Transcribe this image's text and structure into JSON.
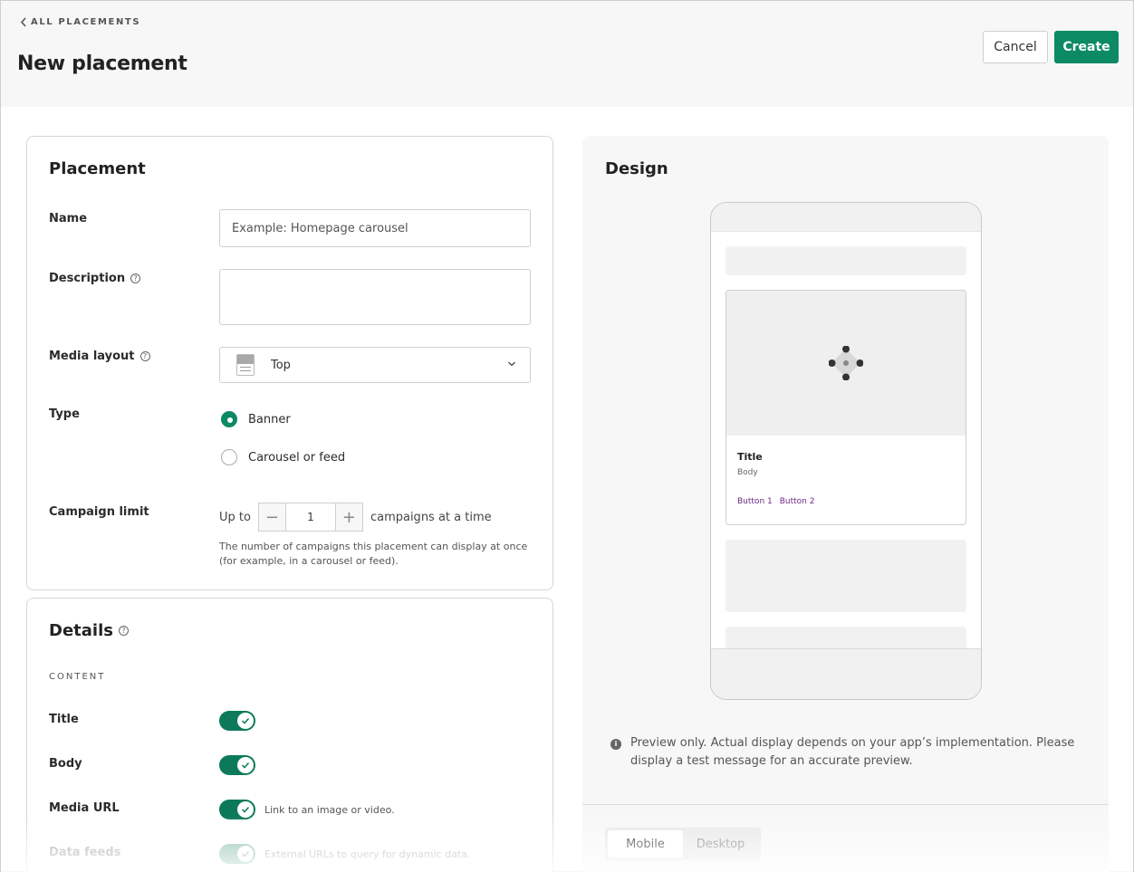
{
  "header": {
    "back_label": "ALL PLACEMENTS",
    "title": "New placement",
    "cancel_label": "Cancel",
    "create_label": "Create"
  },
  "placement": {
    "title": "Placement",
    "name_label": "Name",
    "name_placeholder": "Example: Homepage carousel",
    "description_label": "Description",
    "media_layout_label": "Media layout",
    "media_layout_value": "Top",
    "type_label": "Type",
    "type_options": [
      {
        "label": "Banner",
        "selected": true
      },
      {
        "label": "Carousel or feed",
        "selected": false
      }
    ],
    "campaign_limit_label": "Campaign limit",
    "limit_prefix": "Up to",
    "limit_value": "1",
    "limit_suffix": "campaigns at a time",
    "limit_help": "The number of campaigns this placement can display at once (for example, in a carousel or feed)."
  },
  "details": {
    "title": "Details",
    "content_caption": "CONTENT",
    "fields": [
      {
        "label": "Title",
        "enabled": true,
        "note": ""
      },
      {
        "label": "Body",
        "enabled": true,
        "note": ""
      },
      {
        "label": "Media URL",
        "enabled": true,
        "note": "Link to an image or video."
      },
      {
        "label": "Data feeds",
        "enabled": true,
        "disabled": true,
        "note": "External URLs to query for dynamic data."
      }
    ]
  },
  "design": {
    "title": "Design",
    "card_title": "Title",
    "card_body": "Body",
    "button1": "Button 1",
    "button2": "Button 2",
    "preview_note": "Preview only. Actual display depends on your app’s implementation. Please display a test message for an accurate preview.",
    "tabs": [
      {
        "label": "Mobile",
        "active": true
      },
      {
        "label": "Desktop",
        "active": false
      }
    ]
  },
  "colors": {
    "accent": "#0c8a64",
    "link_purple": "#6b2a86"
  }
}
